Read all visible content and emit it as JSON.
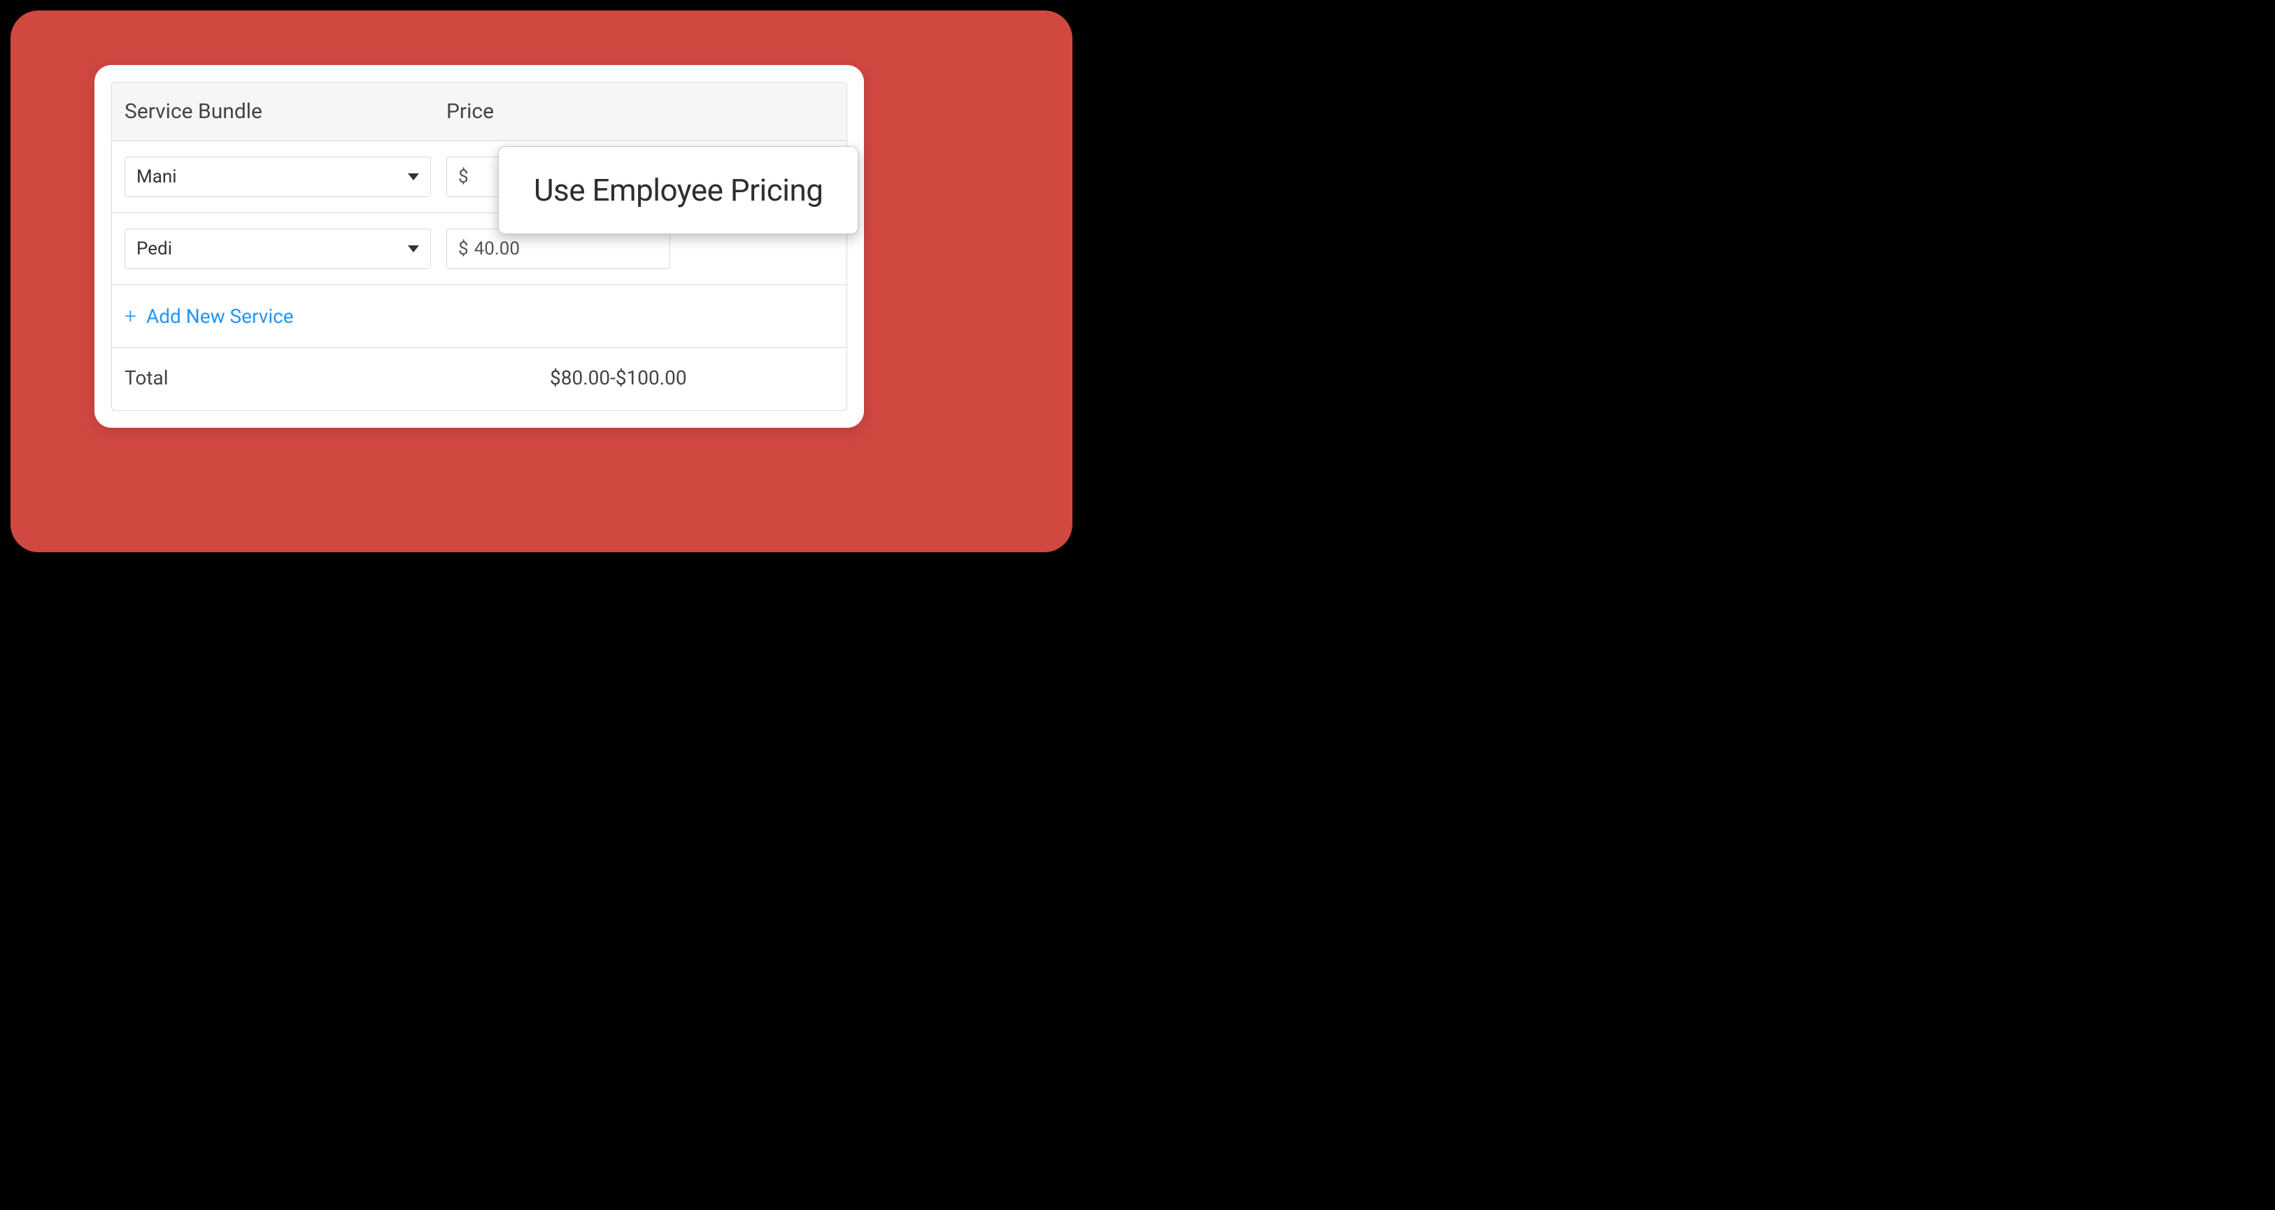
{
  "headers": {
    "service": "Service Bundle",
    "price": "Price"
  },
  "rows": [
    {
      "service": "Mani",
      "currency": "$",
      "price": ""
    },
    {
      "service": "Pedi",
      "currency": "$",
      "price": "40.00"
    }
  ],
  "addService": {
    "label": "Add New Service"
  },
  "total": {
    "label": "Total",
    "value": "$80.00-$100.00"
  },
  "tooltip": {
    "text": "Use Employee Pricing"
  }
}
